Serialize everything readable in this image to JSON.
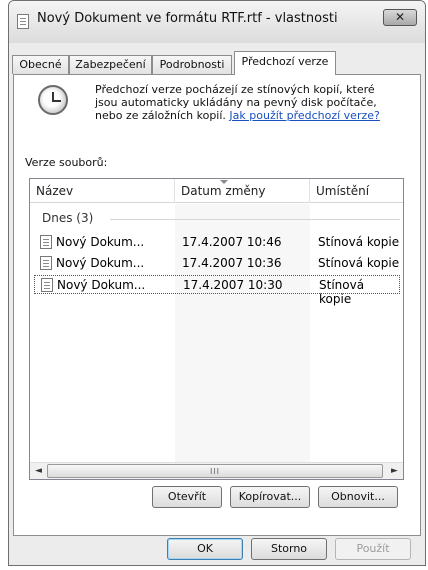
{
  "window": {
    "title": "Nový Dokument ve formátu RTF.rtf - vlastnosti",
    "close_label": "✕"
  },
  "tabs": [
    {
      "label": "Obecné"
    },
    {
      "label": "Zabezpečení"
    },
    {
      "label": "Podrobnosti"
    },
    {
      "label": "Předchozí verze"
    }
  ],
  "info": {
    "line1": "Předchozí verze pocházejí ze stínových kopií, které",
    "line2": "jsou automaticky ukládány na pevný disk počítače,",
    "line3_prefix": "nebo ze záložních kopií.",
    "link": "Jak použít předchozí verze?"
  },
  "versions_label": "Verze souborů:",
  "list": {
    "columns": [
      "Název",
      "Datum změny",
      "Umístění"
    ],
    "group": "Dnes (3)",
    "rows": [
      {
        "name": "Nový Dokum...",
        "date": "17.4.2007 10:46",
        "location": "Stínová kopie"
      },
      {
        "name": "Nový Dokum...",
        "date": "17.4.2007 10:36",
        "location": "Stínová kopie"
      },
      {
        "name": "Nový Dokum...",
        "date": "17.4.2007 10:30",
        "location": "Stínová kopie"
      }
    ],
    "scroll_left": "◄",
    "scroll_right": "►",
    "scroll_grip": "III"
  },
  "actions": {
    "open": "Otevřít",
    "copy": "Kopírovat...",
    "restore": "Obnovit..."
  },
  "footer": {
    "ok": "OK",
    "cancel": "Storno",
    "apply": "Použít"
  }
}
